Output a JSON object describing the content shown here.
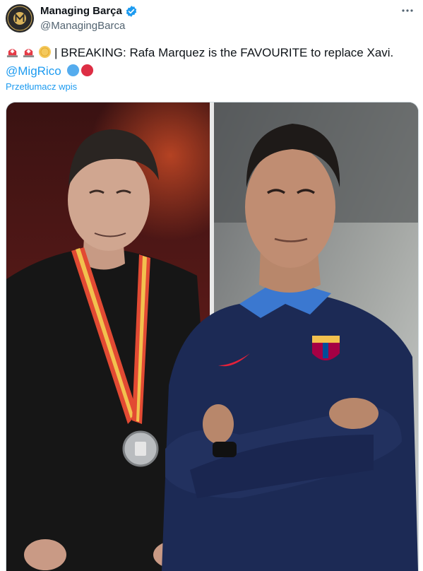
{
  "author": {
    "display_name": "Managing Barça",
    "handle": "@ManagingBarca",
    "verified": true,
    "avatar_text_top": "MANAGING",
    "avatar_text_bottom": "BARÇA",
    "avatar_monogram": "M"
  },
  "tweet": {
    "emojis": [
      "rotating-light",
      "rotating-light",
      "coin"
    ],
    "text_main": "| BREAKING: Rafa Marquez is the FAVOURITE to replace Xavi.",
    "mention": "@MigRico",
    "trailing_emojis": [
      "blue-circle",
      "red-circle"
    ],
    "translate_label": "Przetłumacz wpis"
  },
  "media": {
    "description_left": "xavi-with-medal",
    "description_right": "rafa-marquez-arms-crossed"
  },
  "colors": {
    "accent": "#1d9bf0",
    "text": "#0f1419",
    "secondary": "#536471",
    "verified": "#1d9bf0"
  },
  "icons": {
    "more": "more-icon",
    "verified": "verified-badge-icon"
  }
}
